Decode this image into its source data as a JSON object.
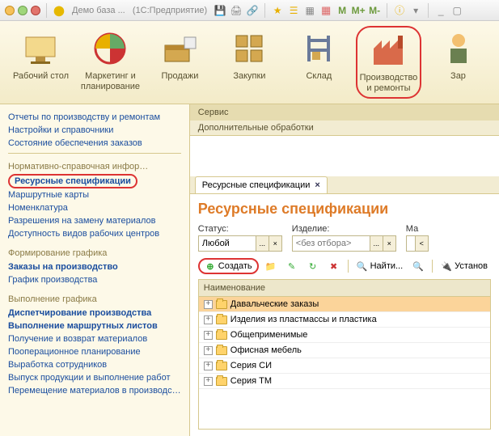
{
  "title": {
    "app": "Демо база ...",
    "suffix": "(1С:Предприятие)"
  },
  "titlebar_icons": [
    "save",
    "print",
    "share",
    "star",
    "bookmarks",
    "calc",
    "calendar",
    "mplain",
    "mplus",
    "mminus",
    "info",
    "dropdown",
    "minimize",
    "restore"
  ],
  "maintools": [
    {
      "label": "Рабочий стол",
      "icon": "desktop"
    },
    {
      "label": "Маркетинг и планирование",
      "icon": "marketing"
    },
    {
      "label": "Продажи",
      "icon": "sales"
    },
    {
      "label": "Закупки",
      "icon": "purchase"
    },
    {
      "label": "Склад",
      "icon": "warehouse"
    },
    {
      "label": "Производство и ремонты",
      "icon": "production",
      "active": true
    },
    {
      "label": "Зар",
      "icon": "salary"
    }
  ],
  "sidebar": {
    "top": [
      "Отчеты по производству и ремонтам",
      "Настройки и справочники",
      "Состояние обеспечения заказов"
    ],
    "g1_head": "Нормативно-справочная инфор…",
    "g1": [
      {
        "label": "Ресурсные спецификации",
        "circled": true
      },
      {
        "label": "Маршрутные карты"
      },
      {
        "label": "Номенклатура"
      },
      {
        "label": "Разрешения на замену материалов"
      },
      {
        "label": "Доступность видов рабочих центров"
      }
    ],
    "g2_head": "Формирование графика",
    "g2": [
      {
        "label": "Заказы на производство",
        "bold": true
      },
      {
        "label": "График производства"
      }
    ],
    "g3_head": "Выполнение графика",
    "g3": [
      {
        "label": "Диспетчирование производства",
        "bold": true
      },
      {
        "label": "Выполнение маршрутных листов",
        "bold": true
      },
      {
        "label": "Получение и возврат материалов"
      },
      {
        "label": "Пооперационное планирование"
      },
      {
        "label": "Выработка сотрудников"
      },
      {
        "label": "Выпуск продукции и выполнение работ"
      },
      {
        "label": "Перемещение материалов в производс…"
      }
    ]
  },
  "service": {
    "head": "Сервис",
    "item": "Дополнительные обработки"
  },
  "tab": {
    "label": "Ресурсные спецификации"
  },
  "panel": {
    "title": "Ресурсные спецификации",
    "status_label": "Статус:",
    "status_value": "Любой",
    "product_label": "Изделие:",
    "product_placeholder": "<без отбора>",
    "m_label": "Ма",
    "ellipsis": "...",
    "x": "×",
    "create": "Создать",
    "find": "Найти...",
    "set": "Установ",
    "colhead": "Наименование",
    "rows": [
      "Давальческие заказы",
      "Изделия из пластмассы и пластика",
      "Общеприменимые",
      "Офисная мебель",
      "Серия СИ",
      "Серия ТМ"
    ]
  }
}
